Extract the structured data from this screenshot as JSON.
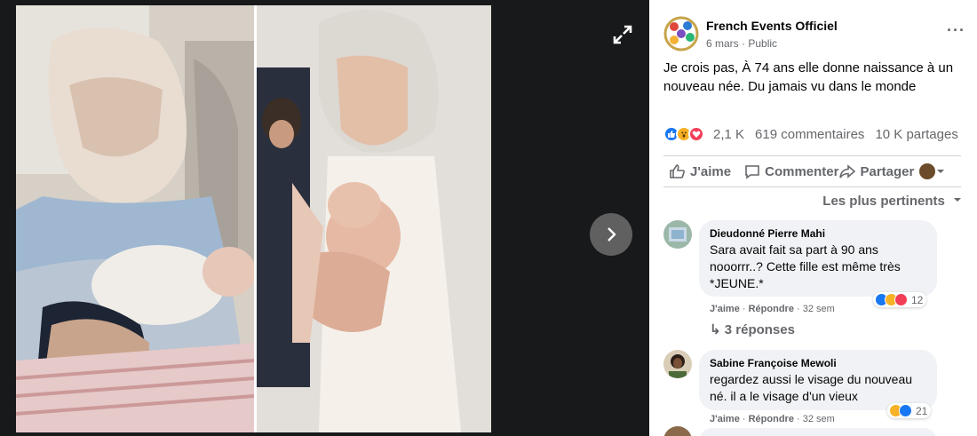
{
  "post": {
    "page_name": "French Events Officiel",
    "date": "6 mars",
    "visibility": "Public",
    "more_icon": "more-horizontal-icon",
    "text": "Je crois pas, À 74 ans elle donne naissance à un nouveau née. Du jamais vu dans le monde"
  },
  "stats": {
    "reactions": "2,1 K",
    "comments": "619 commentaires",
    "shares": "10 K partages",
    "reaction_types": [
      "like",
      "wow",
      "love"
    ]
  },
  "actions": {
    "like": "J'aime",
    "comment": "Commenter",
    "share": "Partager"
  },
  "sort": "Les plus pertinents",
  "comments": [
    {
      "author": "Dieudonné Pierre Mahi",
      "lines": [
        "Sara avait fait sa part à 90 ans",
        "nooorrr..? Cette fille est même très",
        "*JEUNE.*"
      ],
      "like": "J'aime",
      "reply": "Répondre",
      "time": "32 sem",
      "reaction_count": "12",
      "replies": "3 réponses"
    },
    {
      "author": "Sabine Françoise Mewoli",
      "lines": [
        "regardez aussi le visage du nouveau",
        "né. il a le visage d'un vieux"
      ],
      "like": "J'aime",
      "reply": "Répondre",
      "time": "32 sem",
      "reaction_count": "21"
    }
  ],
  "colors": {
    "like_blue": "#1877f2",
    "love_red": "#f33e58",
    "wow_yellow": "#f7b125",
    "secondary_text": "#65676b",
    "bubble_bg": "#f0f2f5"
  }
}
